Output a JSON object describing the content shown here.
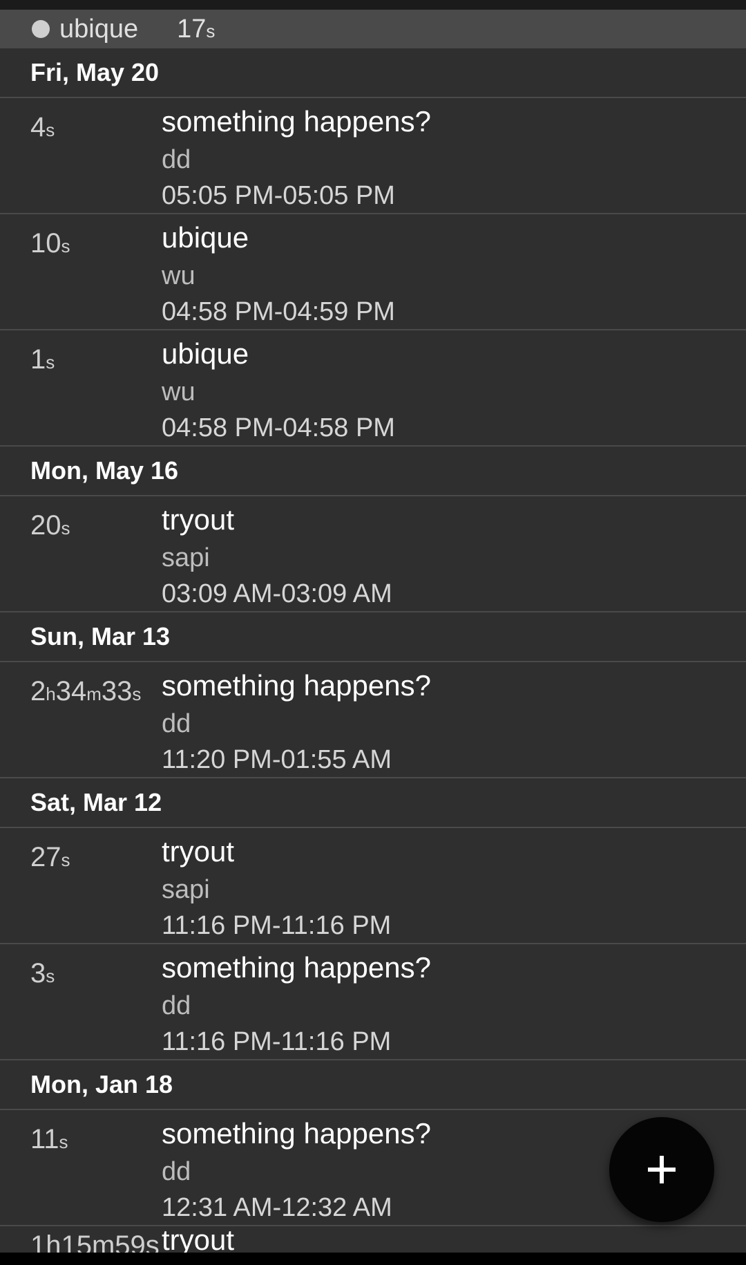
{
  "header": {
    "name": "ubique",
    "duration_num": "17",
    "duration_unit": "s"
  },
  "groups": [
    {
      "date": "Fri, May 20",
      "entries": [
        {
          "d": [
            [
              "4",
              "s"
            ]
          ],
          "title": "something happens?",
          "sub": "dd",
          "time": "05:05 PM-05:05 PM"
        },
        {
          "d": [
            [
              "10",
              "s"
            ]
          ],
          "title": "ubique",
          "sub": "wu",
          "time": "04:58 PM-04:59 PM"
        },
        {
          "d": [
            [
              "1",
              "s"
            ]
          ],
          "title": "ubique",
          "sub": "wu",
          "time": "04:58 PM-04:58 PM"
        }
      ]
    },
    {
      "date": "Mon, May 16",
      "entries": [
        {
          "d": [
            [
              "20",
              "s"
            ]
          ],
          "title": "tryout",
          "sub": "sapi",
          "time": "03:09 AM-03:09 AM"
        }
      ]
    },
    {
      "date": "Sun, Mar 13",
      "entries": [
        {
          "d": [
            [
              "2",
              "h"
            ],
            [
              "34",
              "m"
            ],
            [
              "33",
              "s"
            ]
          ],
          "title": "something happens?",
          "sub": "dd",
          "time": "11:20 PM-01:55 AM"
        }
      ]
    },
    {
      "date": "Sat, Mar 12",
      "entries": [
        {
          "d": [
            [
              "27",
              "s"
            ]
          ],
          "title": "tryout",
          "sub": "sapi",
          "time": "11:16 PM-11:16 PM"
        },
        {
          "d": [
            [
              "3",
              "s"
            ]
          ],
          "title": "something happens?",
          "sub": "dd",
          "time": "11:16 PM-11:16 PM"
        }
      ]
    },
    {
      "date": "Mon, Jan 18",
      "entries": [
        {
          "d": [
            [
              "11",
              "s"
            ]
          ],
          "title": "something happens?",
          "sub": "dd",
          "time": "12:31 AM-12:32 AM"
        }
      ]
    }
  ],
  "peek": {
    "duration": "1h15m59s",
    "title": "tryout"
  },
  "fab": {
    "icon": "plus-icon"
  }
}
